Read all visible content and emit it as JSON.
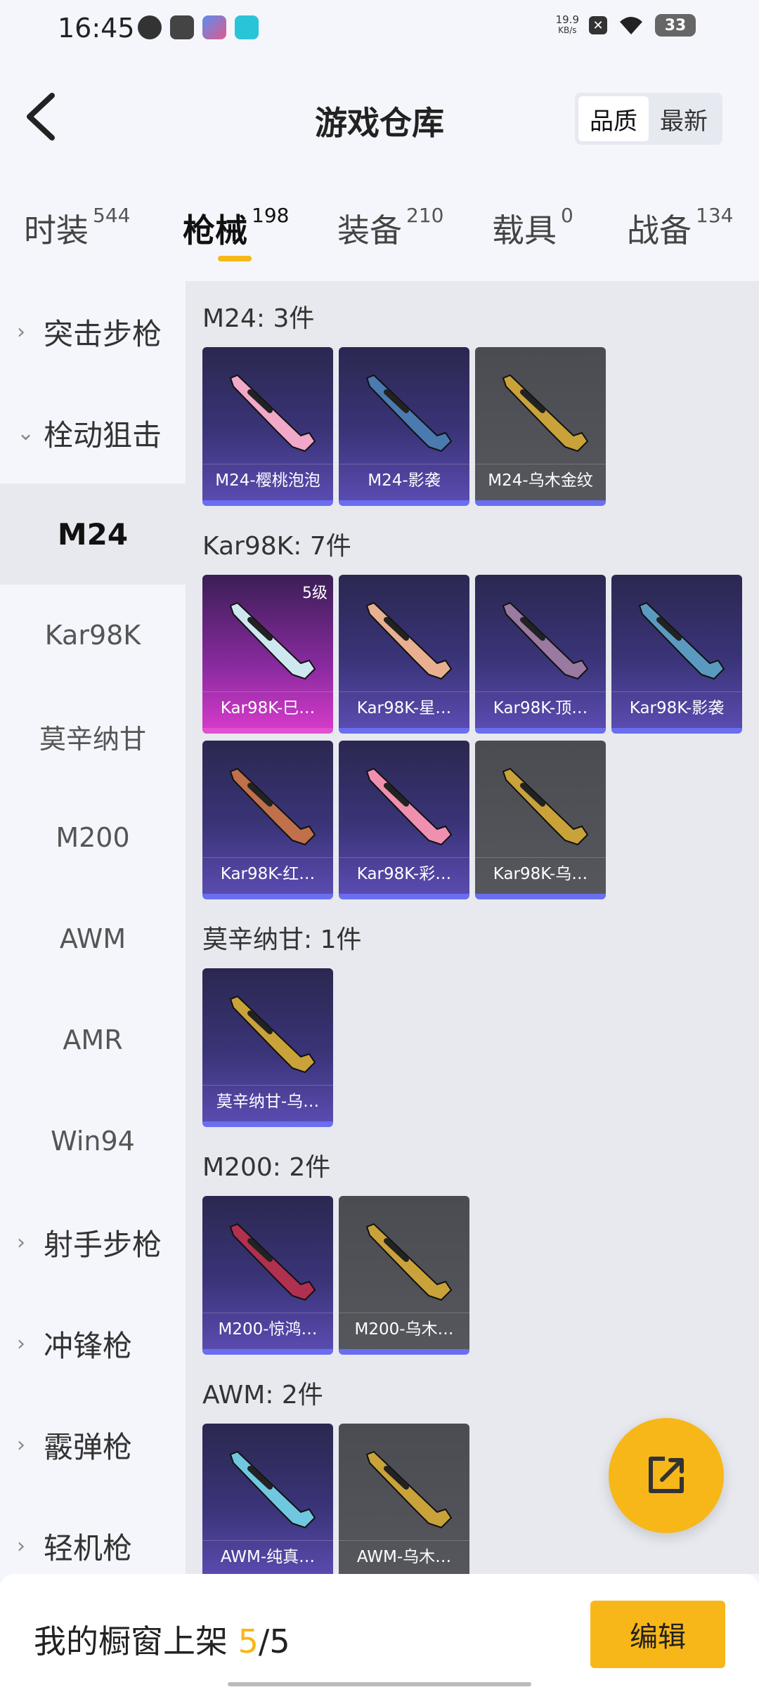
{
  "status": {
    "time": "16:45",
    "net_speed_value": "19.9",
    "net_speed_unit": "KB/s",
    "battery": "33"
  },
  "header": {
    "title": "游戏仓库",
    "sort_options": [
      "品质",
      "最新"
    ],
    "sort_active": 0
  },
  "tabs": [
    {
      "label": "时装",
      "count": "544"
    },
    {
      "label": "枪械",
      "count": "198"
    },
    {
      "label": "装备",
      "count": "210"
    },
    {
      "label": "载具",
      "count": "0"
    },
    {
      "label": "战备",
      "count": "134"
    }
  ],
  "active_tab": 1,
  "sidebar": {
    "items": [
      {
        "label": "突击步枪",
        "type": "group",
        "chevron": "›"
      },
      {
        "label": "栓动狙击",
        "type": "group",
        "chevron": "⌄"
      },
      {
        "label": "M24",
        "type": "sub",
        "selected": true
      },
      {
        "label": "Kar98K",
        "type": "sub"
      },
      {
        "label": "莫辛纳甘",
        "type": "sub"
      },
      {
        "label": "M200",
        "type": "sub"
      },
      {
        "label": "AWM",
        "type": "sub"
      },
      {
        "label": "AMR",
        "type": "sub"
      },
      {
        "label": "Win94",
        "type": "sub"
      },
      {
        "label": "射手步枪",
        "type": "group",
        "chevron": "›"
      },
      {
        "label": "冲锋枪",
        "type": "group",
        "chevron": "›"
      },
      {
        "label": "霰弹枪",
        "type": "group",
        "chevron": "›"
      },
      {
        "label": "轻机枪",
        "type": "group",
        "chevron": "›"
      }
    ]
  },
  "sections": [
    {
      "title": "M24: 3件",
      "items": [
        {
          "name": "M24-樱桃泡泡",
          "style": "purple",
          "gun_color": "#f2a8c8"
        },
        {
          "name": "M24-影袭",
          "style": "purple",
          "gun_color": "#4a7ab0"
        },
        {
          "name": "M24-乌木金纹",
          "style": "gray",
          "gun_color": "#c9a23a"
        }
      ]
    },
    {
      "title": "Kar98K: 7件",
      "items": [
        {
          "name": "Kar98K-巳…",
          "style": "pink",
          "gun_color": "#cfe8f0",
          "level": "5级"
        },
        {
          "name": "Kar98K-星…",
          "style": "purple",
          "gun_color": "#e8b090"
        },
        {
          "name": "Kar98K-顶…",
          "style": "purple",
          "gun_color": "#9a7aa0"
        },
        {
          "name": "Kar98K-影袭",
          "style": "purple",
          "gun_color": "#5a9ac0"
        },
        {
          "name": "Kar98K-红…",
          "style": "purple",
          "gun_color": "#c0704a"
        },
        {
          "name": "Kar98K-彩…",
          "style": "purple",
          "gun_color": "#f090b0"
        },
        {
          "name": "Kar98K-乌…",
          "style": "gray",
          "gun_color": "#c9a23a"
        }
      ]
    },
    {
      "title": "莫辛纳甘: 1件",
      "items": [
        {
          "name": "莫辛纳甘-乌…",
          "style": "purple",
          "gun_color": "#c9a23a"
        }
      ]
    },
    {
      "title": "M200: 2件",
      "items": [
        {
          "name": "M200-惊鸿…",
          "style": "purple",
          "gun_color": "#b03050"
        },
        {
          "name": "M200-乌木…",
          "style": "gray",
          "gun_color": "#c9a23a"
        }
      ]
    },
    {
      "title": "AWM: 2件",
      "items": [
        {
          "name": "AWM-纯真…",
          "style": "purple",
          "gun_color": "#70c8e0"
        },
        {
          "name": "AWM-乌木…",
          "style": "gray",
          "gun_color": "#c9a23a"
        }
      ]
    }
  ],
  "bottom": {
    "showcase_label": "我的橱窗上架",
    "showcase_current": "5",
    "showcase_sep": "/",
    "showcase_total": "5",
    "edit_label": "编辑"
  },
  "colors": {
    "accent": "#f7b718",
    "card_purple": "#3a3478",
    "card_gray": "#55575d",
    "card_pink": "#d33ac8",
    "card_bar": "#6a6ef0"
  }
}
